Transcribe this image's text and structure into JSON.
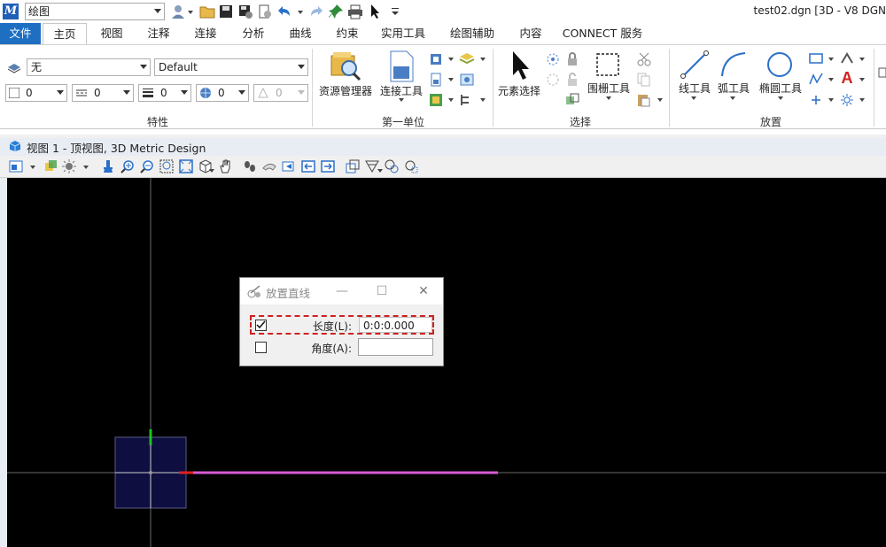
{
  "title_bar": {
    "workflow": "绘图",
    "window_title": "test02.dgn [3D - V8 DGN"
  },
  "tabs": [
    {
      "label": "文件"
    },
    {
      "label": "主页"
    },
    {
      "label": "视图"
    },
    {
      "label": "注释"
    },
    {
      "label": "连接"
    },
    {
      "label": "分析"
    },
    {
      "label": "曲线"
    },
    {
      "label": "约束"
    },
    {
      "label": "实用工具"
    },
    {
      "label": "绘图辅助"
    },
    {
      "label": "内容"
    },
    {
      "label": "CONNECT 服务"
    }
  ],
  "ribbon": {
    "attributes": {
      "level": "无",
      "style": "Default",
      "color": "0",
      "linestyle": "0",
      "weight": "0",
      "class": "0",
      "transparency": "0",
      "group_label": "特性"
    },
    "primary": {
      "explorer_label": "资源管理器",
      "attach_label": "连接工具",
      "group_label": "第一单位"
    },
    "selection": {
      "element_select_label": "元素选择",
      "fence_label": "围栅工具",
      "group_label": "选择"
    },
    "placement": {
      "line_label": "线工具",
      "arc_label": "弧工具",
      "ellipse_label": "椭圆工具",
      "text_glyph": "A",
      "group_label": "放置"
    }
  },
  "view": {
    "title": "视图 1 - 顶视图, 3D Metric Design"
  },
  "dialog": {
    "title": "放置直线",
    "length_label": "长度(L):",
    "length_value": "0:0:0.000",
    "length_checked": true,
    "angle_label": "角度(A):",
    "angle_value": "",
    "angle_checked": false
  },
  "colors": {
    "accent": "#1e6fc2",
    "canvas": "#000000",
    "line": "#d65ad6",
    "x_axis": "#e02020",
    "y_axis": "#20c020"
  }
}
